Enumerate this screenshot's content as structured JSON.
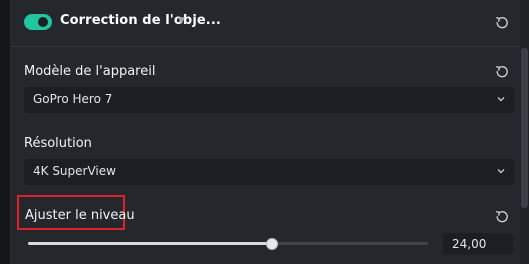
{
  "header": {
    "title": "Correction de l'obje...",
    "enabled": true
  },
  "device": {
    "label": "Modèle de l'appareil",
    "value": "GoPro Hero 7"
  },
  "resolution": {
    "label": "Résolution",
    "value": "4K SuperView"
  },
  "level": {
    "label": "Ajuster le niveau",
    "value": "24,00",
    "fill_fraction": 0.61
  },
  "colors": {
    "accent": "#1fc6a0",
    "highlight": "#e0202a"
  },
  "icons": {
    "reset": "reset-icon",
    "dropdown": "chevron-down-icon",
    "caret": "caret-down-icon"
  }
}
